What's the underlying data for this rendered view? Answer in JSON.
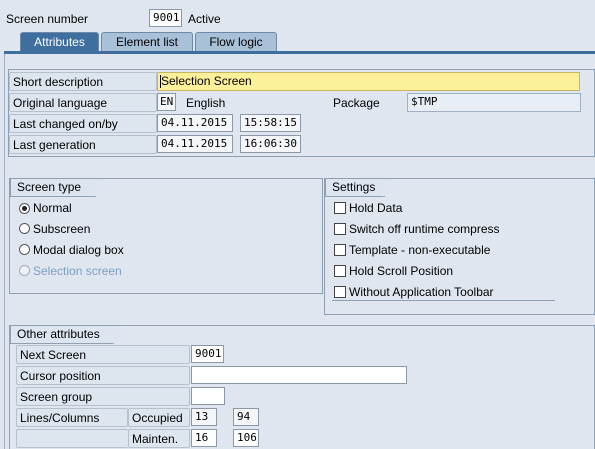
{
  "header": {
    "screen_number_label": "Screen number",
    "screen_number": "9001",
    "status": "Active"
  },
  "tabs": [
    {
      "label": "Attributes",
      "active": true
    },
    {
      "label": "Element list",
      "active": false
    },
    {
      "label": "Flow logic",
      "active": false
    }
  ],
  "attributes": {
    "short_description_label": "Short description",
    "short_description": "Selection Screen",
    "original_language_label": "Original language",
    "language_code": "EN",
    "language_name": "English",
    "package_label": "Package",
    "package": "$TMP",
    "last_changed_label": "Last changed on/by",
    "last_changed_date": "04.11.2015",
    "last_changed_time": "15:58:15",
    "last_generation_label": "Last generation",
    "last_generation_date": "04.11.2015",
    "last_generation_time": "16:06:30"
  },
  "screen_type": {
    "title": "Screen type",
    "options": [
      {
        "label": "Normal",
        "selected": true,
        "enabled": true
      },
      {
        "label": "Subscreen",
        "selected": false,
        "enabled": true
      },
      {
        "label": "Modal dialog box",
        "selected": false,
        "enabled": true
      },
      {
        "label": "Selection screen",
        "selected": false,
        "enabled": false
      }
    ]
  },
  "settings": {
    "title": "Settings",
    "options": [
      {
        "label": "Hold Data",
        "checked": false
      },
      {
        "label": "Switch off runtime compress",
        "checked": false
      },
      {
        "label": "Template - non-executable",
        "checked": false
      },
      {
        "label": "Hold Scroll Position",
        "checked": false
      },
      {
        "label": "Without Application Toolbar",
        "checked": false
      }
    ]
  },
  "other_attributes": {
    "title": "Other attributes",
    "next_screen_label": "Next Screen",
    "next_screen": "9001",
    "cursor_position_label": "Cursor position",
    "cursor_position": "",
    "screen_group_label": "Screen group",
    "screen_group": "",
    "lines_columns_label": "Lines/Columns",
    "occupied_label": "Occupied",
    "occupied_lines": "13",
    "occupied_columns": "94",
    "mainten_label": "Mainten.",
    "mainten_lines": "16",
    "mainten_columns": "106"
  },
  "colors": {
    "background": "#dfe6ef",
    "active_tab": "#3f6f9e",
    "highlight_field": "#fdf09a"
  }
}
